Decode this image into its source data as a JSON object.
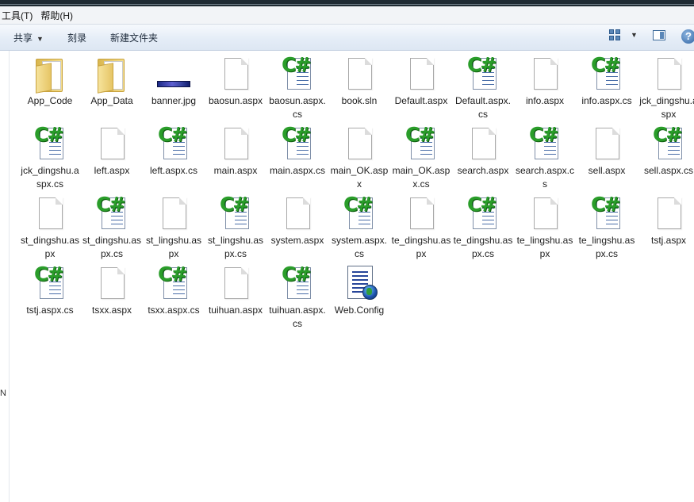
{
  "menubar": {
    "items": [
      "工具(T)",
      "帮助(H)"
    ]
  },
  "toolbar": {
    "share_label": "共享",
    "burn_label": "刻录",
    "new_folder_label": "新建文件夹",
    "help_label": "?"
  },
  "sidebar": {
    "partial_text": "N"
  },
  "files": [
    {
      "name": "App_Code",
      "icon": "folder-icon"
    },
    {
      "name": "App_Data",
      "icon": "folder-icon"
    },
    {
      "name": "banner.jpg",
      "icon": "image-icon"
    },
    {
      "name": "baosun.aspx",
      "icon": "aspx-file-icon"
    },
    {
      "name": "baosun.aspx.cs",
      "icon": "csharp-file-icon"
    },
    {
      "name": "book.sln",
      "icon": "sln-file-icon"
    },
    {
      "name": "Default.aspx",
      "icon": "aspx-file-icon"
    },
    {
      "name": "Default.aspx.cs",
      "icon": "csharp-file-icon"
    },
    {
      "name": "info.aspx",
      "icon": "aspx-file-icon"
    },
    {
      "name": "info.aspx.cs",
      "icon": "csharp-file-icon"
    },
    {
      "name": "jck_dingshu.aspx",
      "icon": "aspx-file-icon"
    },
    {
      "name": "jck_dingshu.aspx.cs",
      "icon": "csharp-file-icon"
    },
    {
      "name": "left.aspx",
      "icon": "aspx-file-icon"
    },
    {
      "name": "left.aspx.cs",
      "icon": "csharp-file-icon"
    },
    {
      "name": "main.aspx",
      "icon": "aspx-file-icon"
    },
    {
      "name": "main.aspx.cs",
      "icon": "csharp-file-icon"
    },
    {
      "name": "main_OK.aspx",
      "icon": "aspx-file-icon"
    },
    {
      "name": "main_OK.aspx.cs",
      "icon": "csharp-file-icon"
    },
    {
      "name": "search.aspx",
      "icon": "aspx-file-icon"
    },
    {
      "name": "search.aspx.cs",
      "icon": "csharp-file-icon"
    },
    {
      "name": "sell.aspx",
      "icon": "aspx-file-icon"
    },
    {
      "name": "sell.aspx.cs",
      "icon": "csharp-file-icon"
    },
    {
      "name": "st_dingshu.aspx",
      "icon": "aspx-file-icon"
    },
    {
      "name": "st_dingshu.aspx.cs",
      "icon": "csharp-file-icon"
    },
    {
      "name": "st_lingshu.aspx",
      "icon": "aspx-file-icon"
    },
    {
      "name": "st_lingshu.aspx.cs",
      "icon": "csharp-file-icon"
    },
    {
      "name": "system.aspx",
      "icon": "aspx-file-icon"
    },
    {
      "name": "system.aspx.cs",
      "icon": "csharp-file-icon"
    },
    {
      "name": "te_dingshu.aspx",
      "icon": "aspx-file-icon"
    },
    {
      "name": "te_dingshu.aspx.cs",
      "icon": "csharp-file-icon"
    },
    {
      "name": "te_lingshu.aspx",
      "icon": "aspx-file-icon"
    },
    {
      "name": "te_lingshu.aspx.cs",
      "icon": "csharp-file-icon"
    },
    {
      "name": "tstj.aspx",
      "icon": "aspx-file-icon"
    },
    {
      "name": "tstj.aspx.cs",
      "icon": "csharp-file-icon"
    },
    {
      "name": "tsxx.aspx",
      "icon": "aspx-file-icon"
    },
    {
      "name": "tsxx.aspx.cs",
      "icon": "csharp-file-icon"
    },
    {
      "name": "tuihuan.aspx",
      "icon": "aspx-file-icon"
    },
    {
      "name": "tuihuan.aspx.cs",
      "icon": "csharp-file-icon"
    },
    {
      "name": "Web.Config",
      "icon": "config-file-icon"
    }
  ]
}
